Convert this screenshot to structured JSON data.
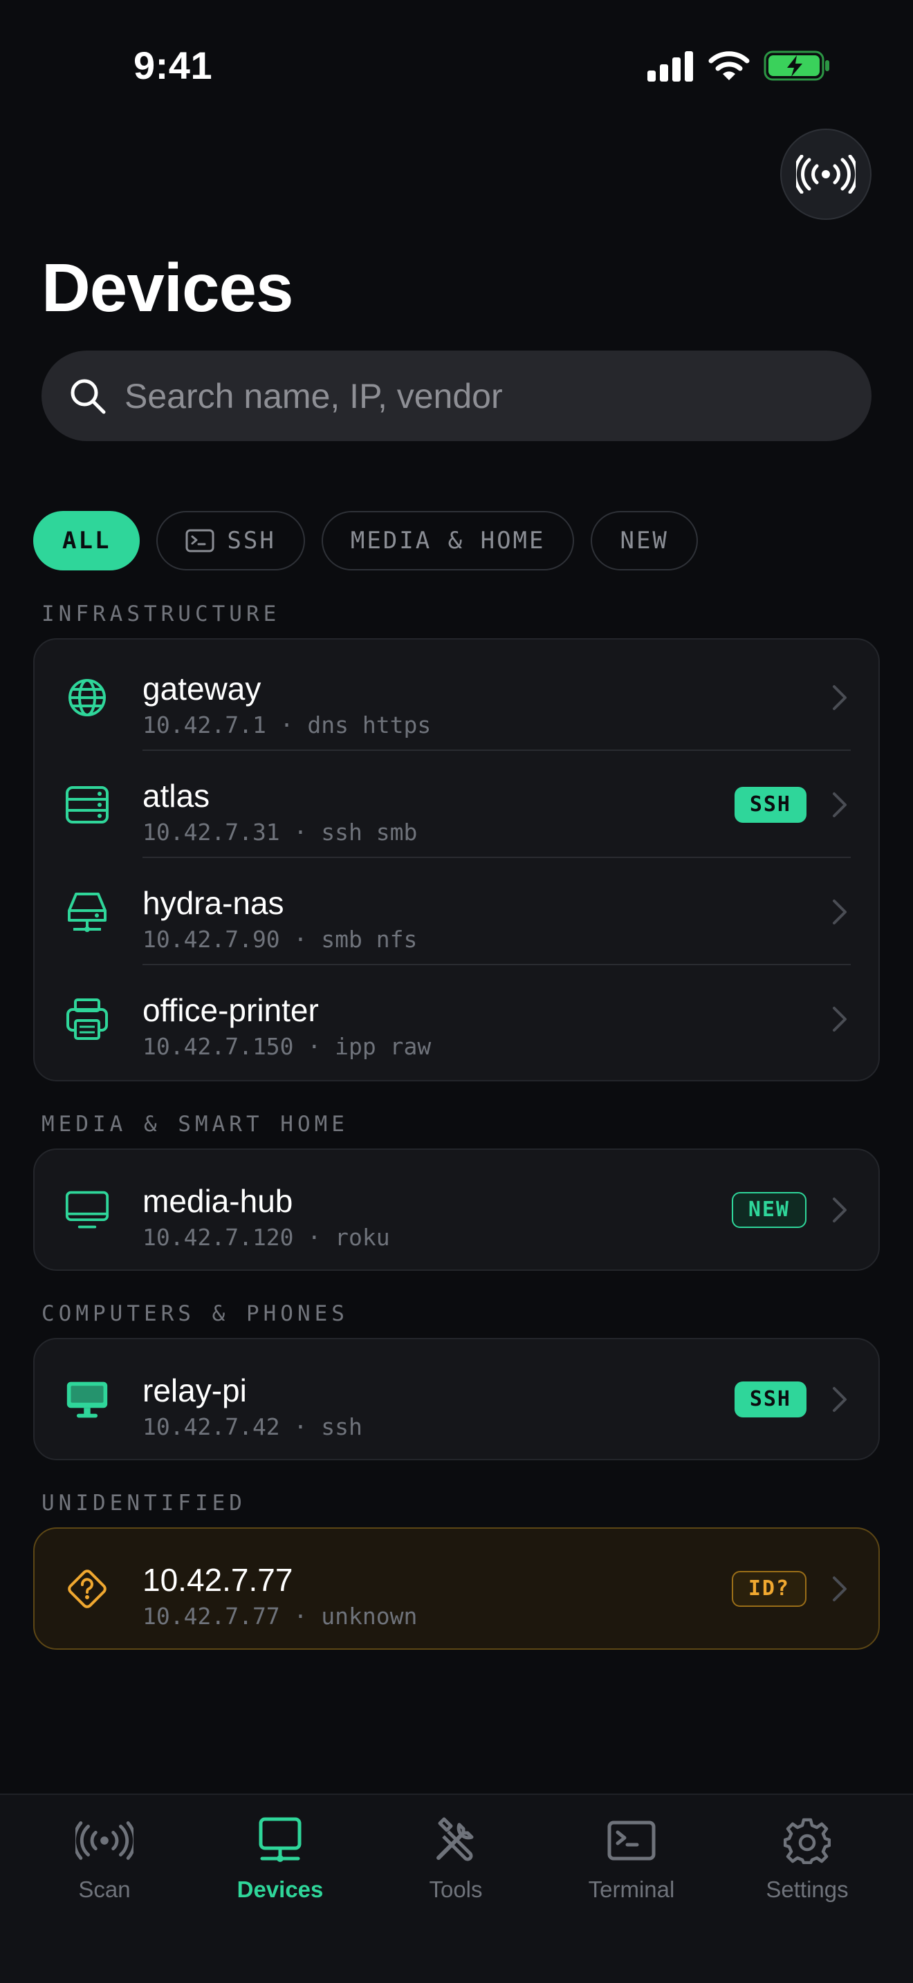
{
  "status_bar": {
    "time": "9:41"
  },
  "header": {
    "title": "Devices"
  },
  "search": {
    "placeholder": "Search name, IP, vendor"
  },
  "filters": [
    {
      "label": "ALL",
      "active": true
    },
    {
      "label": "SSH",
      "icon": "terminal-icon"
    },
    {
      "label": "MEDIA & HOME"
    },
    {
      "label": "NEW"
    }
  ],
  "sections": [
    {
      "label": "INFRASTRUCTURE",
      "devices": [
        {
          "name": "gateway",
          "meta": "10.42.7.1 · dns https",
          "icon": "globe-icon"
        },
        {
          "name": "atlas",
          "meta": "10.42.7.31 · ssh smb",
          "icon": "server-icon",
          "badge": "SSH"
        },
        {
          "name": "hydra-nas",
          "meta": "10.42.7.90 · smb nfs",
          "icon": "nas-drive-icon"
        },
        {
          "name": "office-printer",
          "meta": "10.42.7.150 · ipp raw",
          "icon": "printer-icon"
        }
      ]
    },
    {
      "label": "MEDIA & SMART HOME",
      "devices": [
        {
          "name": "media-hub",
          "meta": "10.42.7.120 · roku",
          "icon": "tv-icon",
          "badge": "NEW"
        }
      ]
    },
    {
      "label": "COMPUTERS & PHONES",
      "devices": [
        {
          "name": "relay-pi",
          "meta": "10.42.7.42 · ssh",
          "icon": "desktop-icon",
          "badge": "SSH"
        }
      ]
    },
    {
      "label": "UNIDENTIFIED",
      "devices": [
        {
          "name": "10.42.7.77",
          "meta": "10.42.7.77 · unknown",
          "icon": "question-diamond-icon",
          "badge": "ID?"
        }
      ]
    }
  ],
  "tabs": [
    {
      "label": "Scan",
      "icon": "broadcast-icon"
    },
    {
      "label": "Devices",
      "icon": "devices-icon",
      "active": true
    },
    {
      "label": "Tools",
      "icon": "tools-icon"
    },
    {
      "label": "Terminal",
      "icon": "terminal-icon"
    },
    {
      "label": "Settings",
      "icon": "gear-icon"
    }
  ],
  "colors": {
    "accent": "#2fd69a",
    "warning": "#f0a830",
    "background": "#0b0c0f",
    "card": "#15161a"
  }
}
